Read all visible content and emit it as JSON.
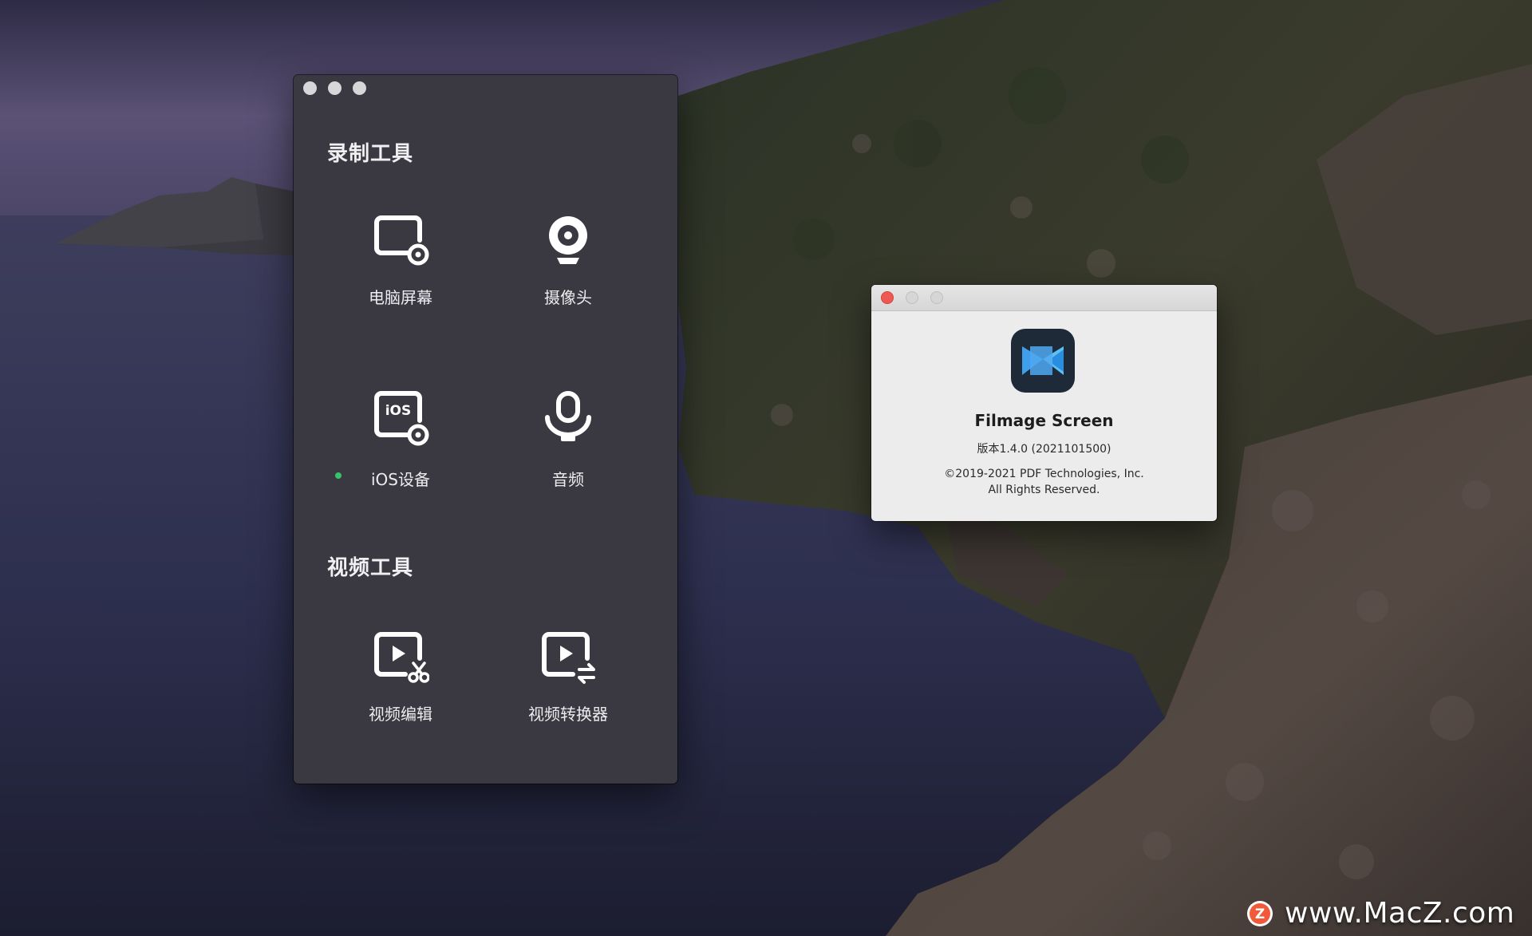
{
  "tools_window": {
    "recording_section_title": "录制工具",
    "video_section_title": "视频工具",
    "tools": {
      "computer_screen": {
        "label": "电脑屏幕",
        "icon": "screen-record-icon"
      },
      "camera": {
        "label": "摄像头",
        "icon": "webcam-icon"
      },
      "ios_device": {
        "label": "iOS设备",
        "icon": "ios-record-icon",
        "icon_text": "iOS",
        "connected": true
      },
      "audio": {
        "label": "音频",
        "icon": "microphone-icon"
      },
      "video_editor": {
        "label": "视频编辑",
        "icon": "video-edit-icon"
      },
      "video_converter": {
        "label": "视频转换器",
        "icon": "video-convert-icon"
      }
    },
    "status_color": "#34c46c"
  },
  "about_window": {
    "app_name": "Filmage Screen",
    "version": "版本1.4.0 (2021101500)",
    "copyright_line1": "©2019-2021 PDF Technologies, Inc.",
    "copyright_line2": "All Rights Reserved.",
    "icon": "filmage-app-icon",
    "icon_color": "#4fa8f0"
  },
  "watermark": {
    "text": "www.MacZ.com",
    "logo_letter": "Z",
    "logo_color": "#f05a3a"
  }
}
